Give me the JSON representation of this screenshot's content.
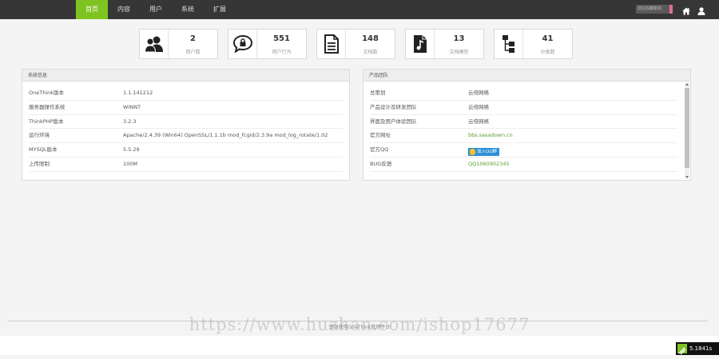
{
  "nav": {
    "items": [
      {
        "label": "首页",
        "active": true
      },
      {
        "label": "内容",
        "active": false
      },
      {
        "label": "用户",
        "active": false
      },
      {
        "label": "系统",
        "active": false
      },
      {
        "label": "扩展",
        "active": false
      }
    ],
    "accent_color": "#7ec321"
  },
  "topbar": {
    "user_label": "前往收藏新闻"
  },
  "stats": [
    {
      "value": "2",
      "label": "用户数",
      "icon": "users-icon"
    },
    {
      "value": "551",
      "label": "用户行为",
      "icon": "chat-bubble-icon"
    },
    {
      "value": "148",
      "label": "文档数",
      "icon": "document-icon"
    },
    {
      "value": "13",
      "label": "文档模型",
      "icon": "music-file-icon"
    },
    {
      "value": "41",
      "label": "分类数",
      "icon": "sitemap-icon"
    }
  ],
  "system_panel": {
    "title": "系统信息",
    "rows": [
      {
        "key": "OneThink版本",
        "value": "1.1.141212"
      },
      {
        "key": "服务器操作系统",
        "value": "WINNT"
      },
      {
        "key": "ThinkPHP版本",
        "value": "3.2.3"
      },
      {
        "key": "运行环境",
        "value": "Apache/2.4.39 (Win64) OpenSSL/1.1.1b mod_fcgid/2.3.9a mod_log_rotate/1.02"
      },
      {
        "key": "MYSQL版本",
        "value": "5.5.29"
      },
      {
        "key": "上传限制",
        "value": "100M"
      }
    ]
  },
  "team_panel": {
    "title": "产品团队",
    "rows": [
      {
        "key": "总策划",
        "value": "云倍网络"
      },
      {
        "key": "产品设计及研发团队",
        "value": "云倍网络"
      },
      {
        "key": "界面及用户体验团队",
        "value": "云倍网络"
      },
      {
        "key": "官方网址",
        "value": "bbs.sasadown.cn"
      },
      {
        "key": "官方QQ",
        "value": "加入QQ群"
      },
      {
        "key": "BUG反馈",
        "value": "QQ1060902345"
      }
    ]
  },
  "footer": {
    "text": "感谢使用OneThink管理平台",
    "watermark": "https://www.huzhan.com/ishop17677",
    "timer": "5.1841s"
  }
}
